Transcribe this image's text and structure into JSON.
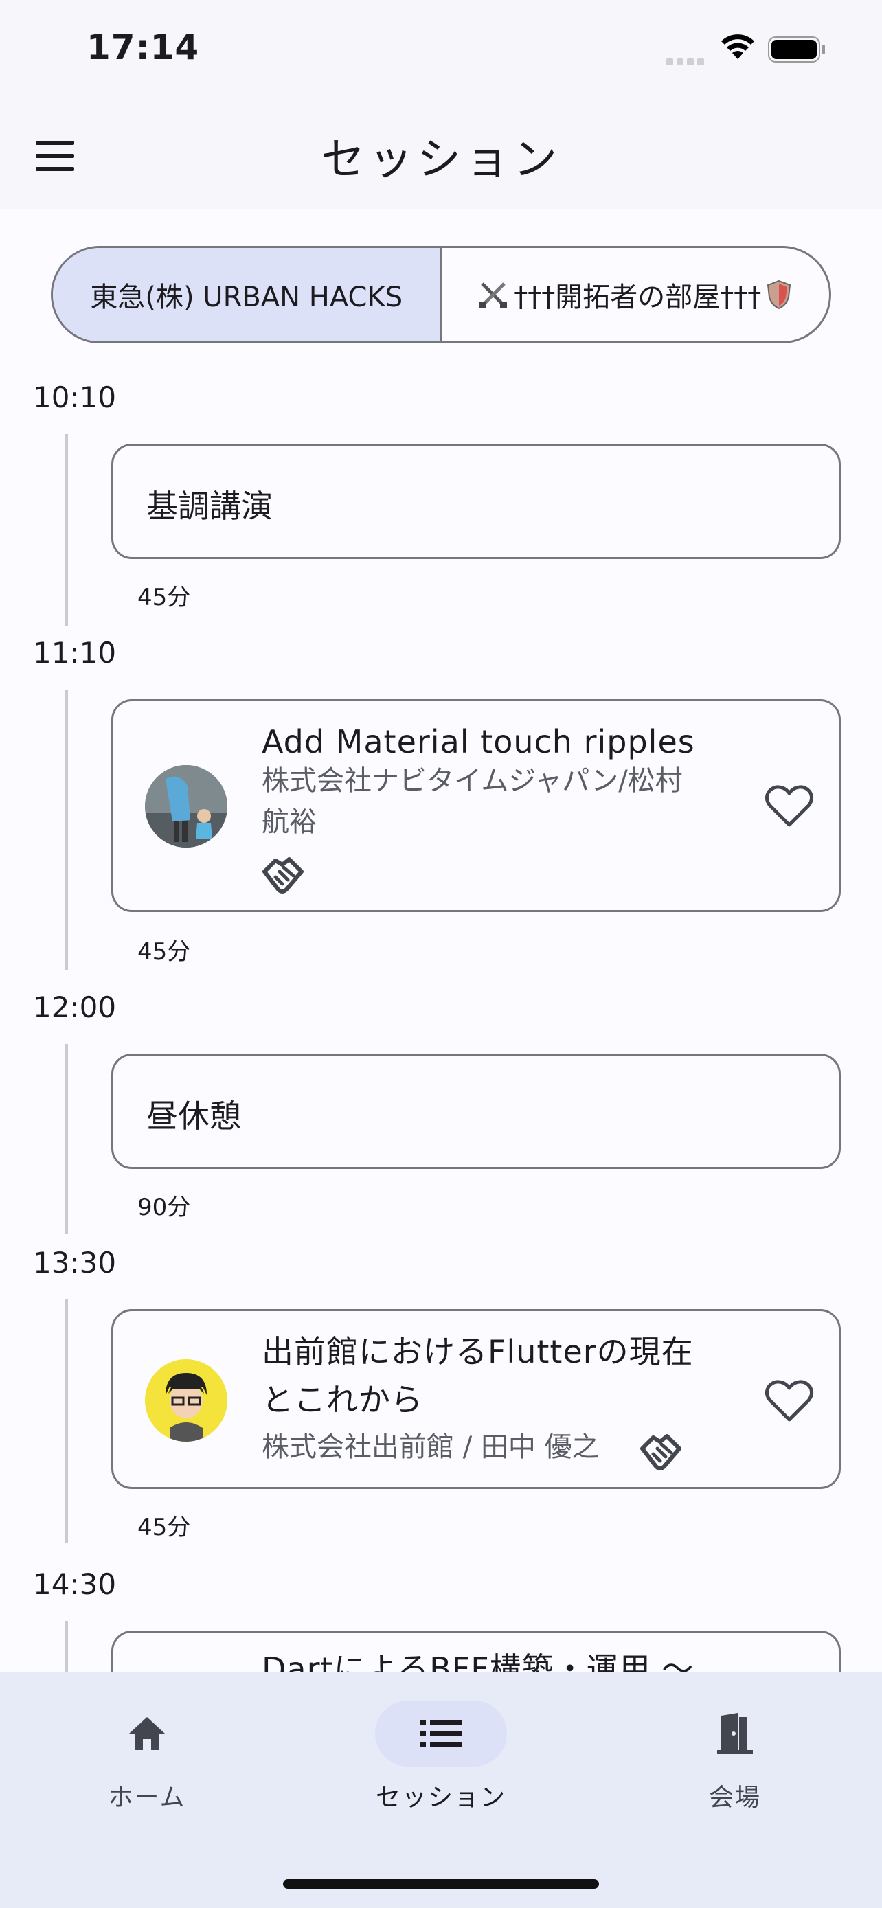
{
  "status_bar": {
    "time": "17:14"
  },
  "app_bar": {
    "title": "セッション",
    "menu_icon": "menu-icon"
  },
  "segments": [
    {
      "label": "東急(株) URBAN HACKS",
      "selected": true
    },
    {
      "prefix_icon": "crossed-swords-icon",
      "label": "†††開拓者の部屋†††",
      "suffix_icon": "shield-icon",
      "selected": false
    }
  ],
  "slots": [
    {
      "time": "10:10",
      "title": "基調講演",
      "duration": "45分"
    },
    {
      "time": "11:10",
      "title": "Add Material touch ripples",
      "speaker_line1": "株式会社ナビタイムジャパン/松村",
      "speaker_line2": "航裕",
      "duration": "45分",
      "tag_icon": "handshake-icon",
      "favorite_icon": "heart-outline-icon"
    },
    {
      "time": "12:00",
      "title": "昼休憩",
      "duration": "90分"
    },
    {
      "time": "13:30",
      "title_line1": "出前館におけるFlutterの現在",
      "title_line2": "とこれから",
      "speaker": "株式会社出前館 / 田中 優之",
      "duration": "45分",
      "tag_icon": "handshake-icon",
      "favorite_icon": "heart-outline-icon"
    },
    {
      "time": "14:30",
      "title": "DartによるBFF構築・運用 〜"
    }
  ],
  "bottom_nav": [
    {
      "label": "ホーム",
      "icon": "home-icon",
      "active": false
    },
    {
      "label": "セッション",
      "icon": "list-icon",
      "active": true
    },
    {
      "label": "会場",
      "icon": "door-icon",
      "active": false
    }
  ],
  "colors": {
    "accent": "#dde1f8",
    "outline": "#75777f",
    "nav_background": "#e6ebf7"
  }
}
